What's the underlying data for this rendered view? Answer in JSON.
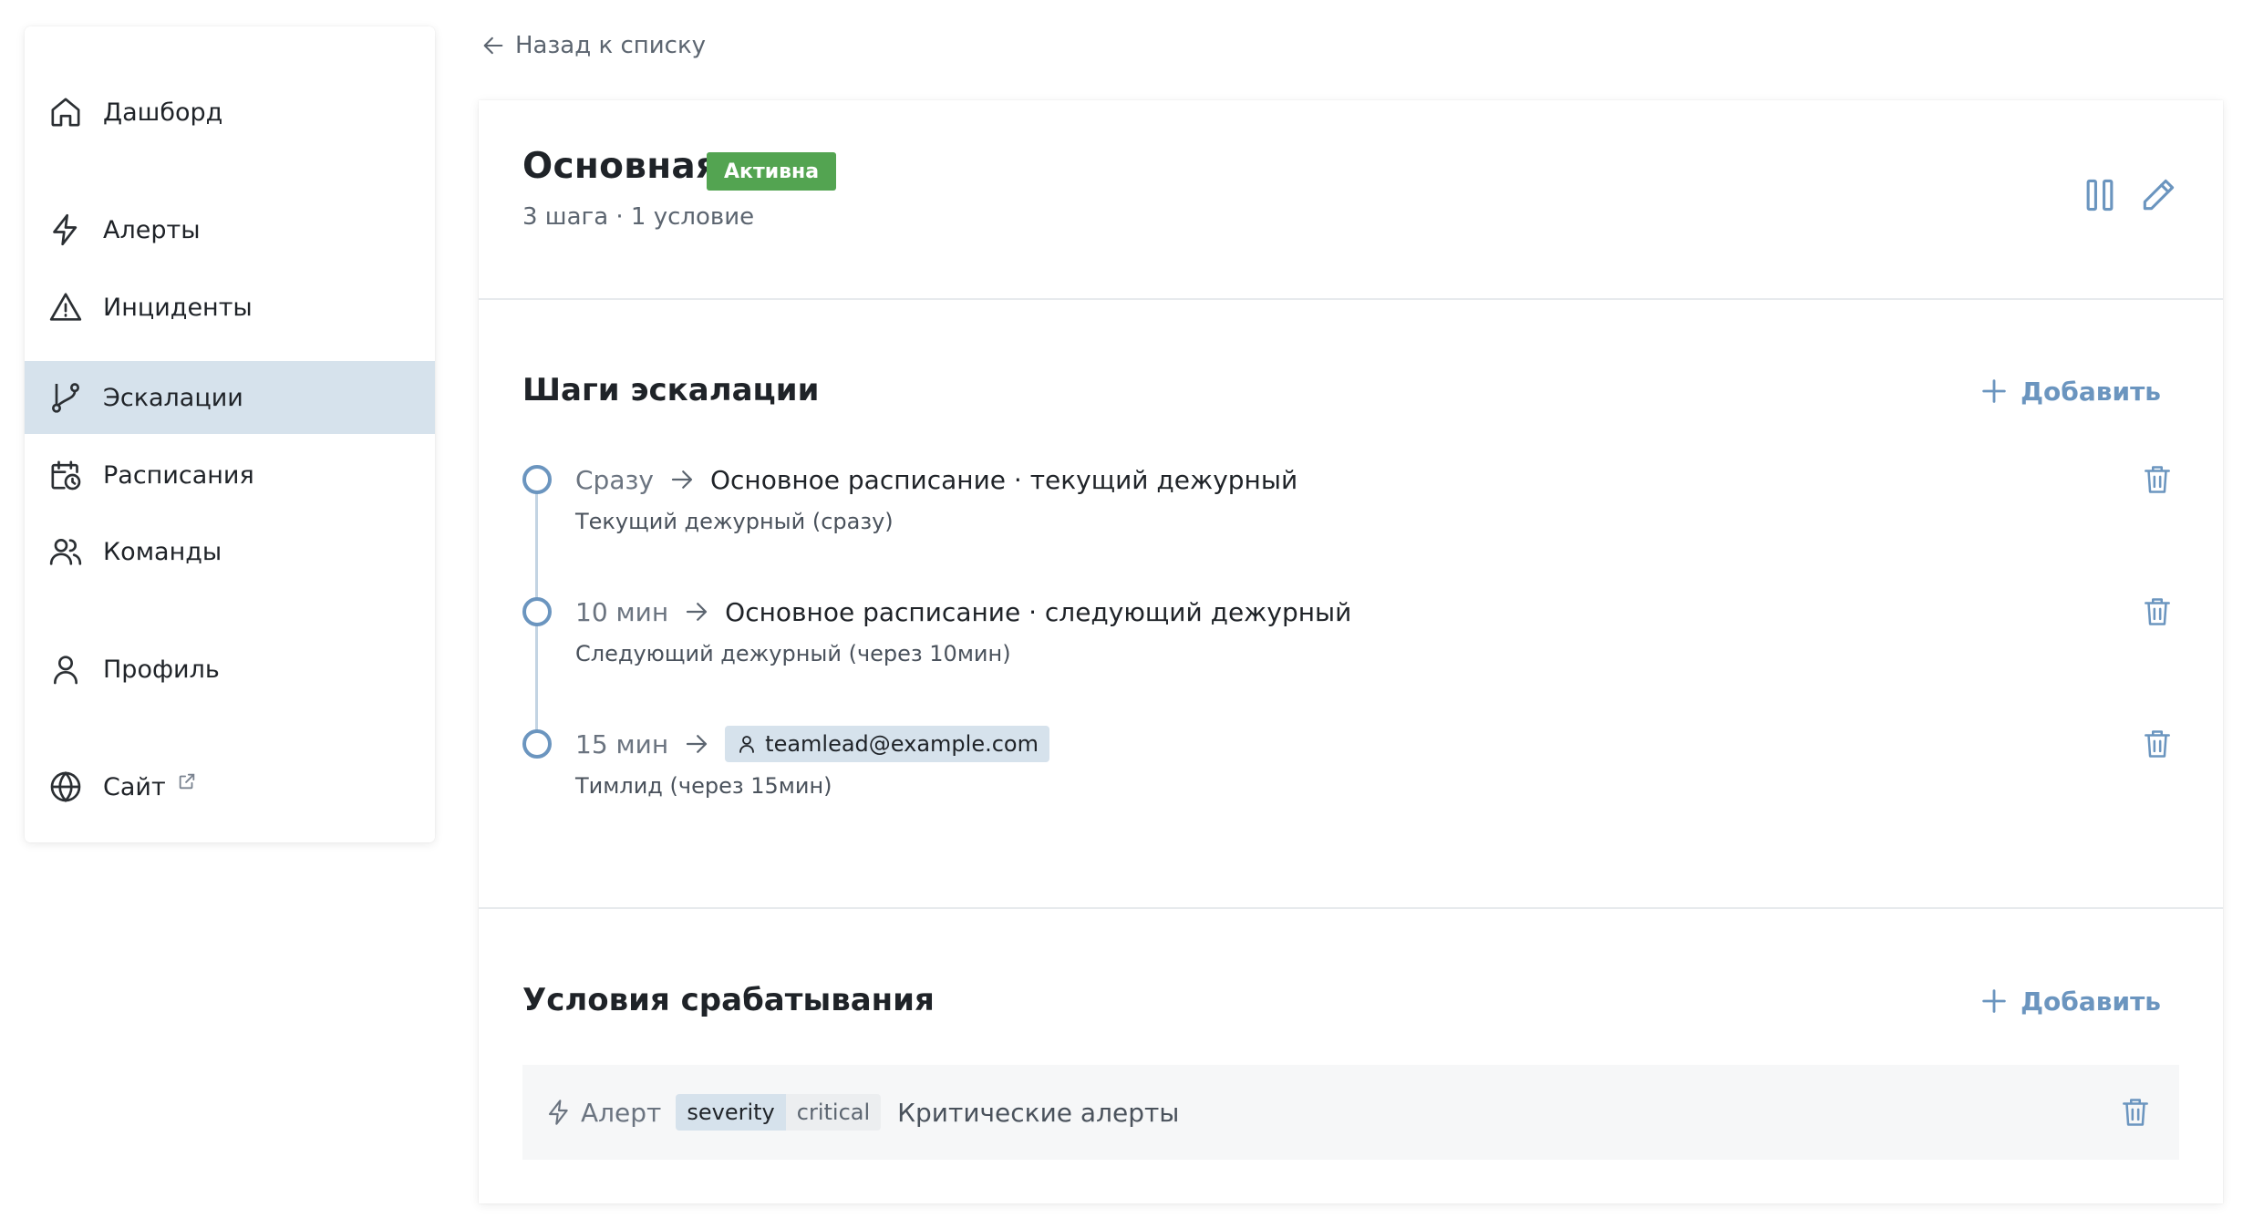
{
  "sidebar": {
    "items": [
      {
        "label": "Дашборд",
        "icon": "home-icon"
      },
      {
        "label": "Алерты",
        "icon": "bolt-icon"
      },
      {
        "label": "Инциденты",
        "icon": "warning-icon"
      },
      {
        "label": "Эскалации",
        "icon": "git-branch-icon",
        "active": true
      },
      {
        "label": "Расписания",
        "icon": "calendar-clock-icon"
      },
      {
        "label": "Команды",
        "icon": "users-icon"
      },
      {
        "label": "Профиль",
        "icon": "user-icon"
      },
      {
        "label": "Сайт",
        "icon": "globe-icon",
        "external_icon": "external-link-icon"
      }
    ]
  },
  "back_link": {
    "label": "Назад к списку",
    "icon": "arrow-left-icon"
  },
  "policy": {
    "title": "Основная",
    "status": "Активна",
    "status_color": "#53a451",
    "subtitle": "3 шага · 1 условие",
    "actions": [
      "pause-icon",
      "pencil-icon"
    ]
  },
  "steps_section": {
    "title": "Шаги эскалации",
    "add_label": "Добавить",
    "steps": [
      {
        "delay": "Сразу",
        "target": "Основное расписание · текущий дежурный",
        "description": "Текущий дежурный (сразу)"
      },
      {
        "delay": "10 мин",
        "target": "Основное расписание · следующий дежурный",
        "description": "Следующий дежурный (через 10мин)"
      },
      {
        "delay": "15 мин",
        "target": "teamlead@example.com",
        "target_icon": "user-icon",
        "description": "Тимлид (через 15мин)"
      }
    ]
  },
  "conditions_section": {
    "title": "Условия срабатывания",
    "add_label": "Добавить",
    "conditions": [
      {
        "type": "Алерт",
        "type_icon": "bolt-icon",
        "key": "severity",
        "value": "critical",
        "description": "Критические алерты"
      }
    ]
  },
  "colors": {
    "accent": "#6b95bf",
    "active_nav_bg": "#d6e2ec",
    "chip_bg": "#d6e2ec"
  }
}
